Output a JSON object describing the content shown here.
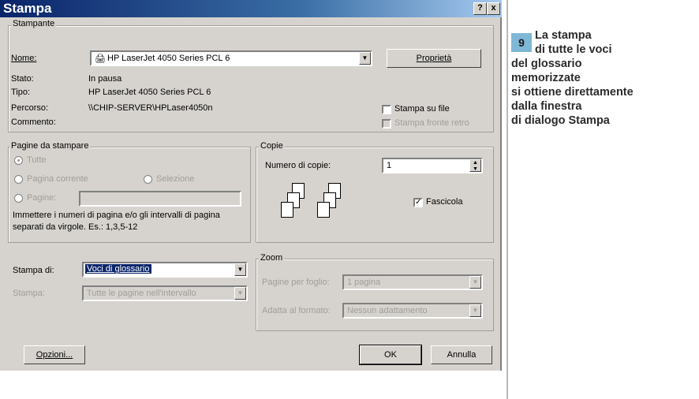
{
  "dialog": {
    "title": "Stampa",
    "help_btn": "?",
    "close_btn": "x"
  },
  "printer": {
    "legend": "Stampante",
    "name_label": "Nome:",
    "name_value": "HP LaserJet 4050 Series PCL 6",
    "properties_btn": "Proprietà",
    "status_label": "Stato:",
    "status_value": "In pausa",
    "type_label": "Tipo:",
    "type_value": "HP LaserJet 4050 Series PCL 6",
    "path_label": "Percorso:",
    "path_value": "\\\\CHIP-SERVER\\HPLaser4050n",
    "comment_label": "Commento:",
    "print_to_file": "Stampa su file",
    "duplex": "Stampa fronte retro"
  },
  "pages": {
    "legend": "Pagine da stampare",
    "all": "Tutte",
    "current": "Pagina corrente",
    "selection": "Selezione",
    "pages": "Pagine:",
    "hint": "Immettere i numeri di pagina e/o gli intervalli di pagina separati da virgole. Es.: 1,3,5-12"
  },
  "copies": {
    "legend": "Copie",
    "count_label": "Numero di copie:",
    "count_value": "1",
    "collate": "Fascicola"
  },
  "print_what": {
    "label": "Stampa di:",
    "value": "Voci di glossario",
    "print_label": "Stampa:",
    "print_value": "Tutte le pagine nell'intervallo"
  },
  "zoom": {
    "legend": "Zoom",
    "pages_per_sheet_label": "Pagine per foglio:",
    "pages_per_sheet_value": "1 pagina",
    "fit_label": "Adatta al formato:",
    "fit_value": "Nessun adattamento"
  },
  "footer": {
    "options_btn": "Opzioni...",
    "ok_btn": "OK",
    "cancel_btn": "Annulla"
  },
  "caption": {
    "number": "9",
    "line1": "La stampa",
    "line2": "di tutte le voci",
    "line3": "del glossario",
    "line4": "memorizzate",
    "line5": "si ottiene direttamente",
    "line6": "dalla finestra",
    "line7": "di dialogo Stampa"
  }
}
